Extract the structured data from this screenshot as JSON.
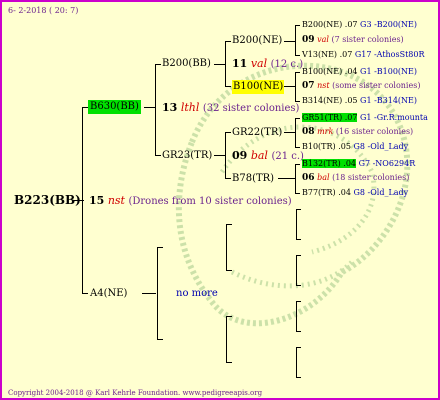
{
  "header": {
    "date": "6- 2-2018 ( 20: 7)"
  },
  "footer": {
    "copyright": "Copyright 2004-2018 @ Karl Kehrle Foundation.   www.pedigreeapis.org"
  },
  "main_node": {
    "name": "B223(BB)",
    "num": "15",
    "code": "nst",
    "note": "(Drones from 10 sister colonies)"
  },
  "gen1": {
    "top": {
      "name": "B630(BB)",
      "num": "13",
      "code": "lthl",
      "note": "(32 sister colonies)"
    },
    "bottom": {
      "name": "A4(NE)",
      "note": "no more"
    }
  },
  "gen2": {
    "a": {
      "name": "B200(BB)",
      "num": "11",
      "code": "val",
      "note": "(12 c.)"
    },
    "b": {
      "name": "GR23(TR)",
      "num": "09",
      "code": "bal",
      "note": "(21 c.)"
    }
  },
  "gen3": {
    "a1": {
      "name": "B200(NE)"
    },
    "a2": {
      "name": "B100(NE)"
    },
    "b1": {
      "name": "GR22(TR)"
    },
    "b2": {
      "name": "B78(TR)"
    }
  },
  "gen4": [
    {
      "name": "B200(NE) .07",
      "group": "G3 -B200(NE)"
    },
    {
      "num": "09",
      "code": "val",
      "note": "(7 sister colonies)"
    },
    {
      "name": "V13(NE) .07",
      "group": "G17 -AthosSt80R"
    },
    {
      "name": "B100(NE) .04",
      "group": "G1 -B100(NE)"
    },
    {
      "num": "07",
      "code": "nst",
      "note": "(some sister colonies)"
    },
    {
      "name": "B314(NE) .05",
      "group": "G1 -B314(NE)"
    },
    {
      "name": "GR51(TR) .07",
      "group": "G1 -Gr.R.mounta"
    },
    {
      "num": "08",
      "code": "mrk",
      "note": "(16 sister colonies)"
    },
    {
      "name": "B10(TR) .05",
      "group": "G8 -Old_Lady"
    },
    {
      "name": "B132(TR) .04",
      "group": "G7 -NO6294R"
    },
    {
      "num": "06",
      "code": "bal",
      "note": "(18 sister colonies)"
    },
    {
      "name": "B77(TR) .04",
      "group": "G8 -Old_Lady"
    }
  ],
  "colors": {
    "border": "#cc00cc",
    "background": "#ffffd0",
    "highlight_green": "#00e000",
    "highlight_yellow": "#ffff00",
    "code_red": "#d00000"
  }
}
